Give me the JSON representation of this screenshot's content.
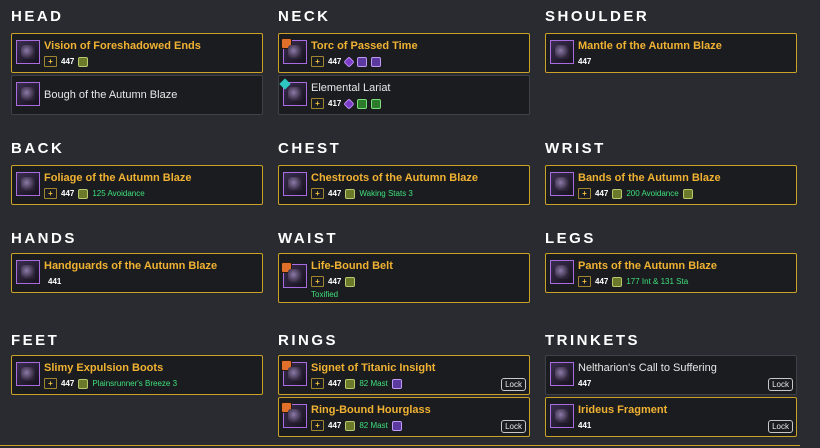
{
  "slots": {
    "head": {
      "title": "HEAD",
      "items": [
        {
          "name": "Vision of Foreshadowed Ends",
          "plus": "+",
          "ilvl": "447"
        },
        {
          "name": "Bough of the Autumn Blaze"
        }
      ]
    },
    "neck": {
      "title": "NECK",
      "items": [
        {
          "name": "Torc of Passed Time",
          "plus": "+",
          "ilvl": "447"
        },
        {
          "name": "Elemental Lariat",
          "plus": "+",
          "ilvl": "417"
        }
      ]
    },
    "shoulder": {
      "title": "SHOULDER",
      "items": [
        {
          "name": "Mantle of the Autumn Blaze",
          "ilvl": "447"
        }
      ]
    },
    "back": {
      "title": "BACK",
      "items": [
        {
          "name": "Foliage of the Autumn Blaze",
          "plus": "+",
          "ilvl": "447",
          "enchant": "125 Avoidance"
        }
      ]
    },
    "chest": {
      "title": "CHEST",
      "items": [
        {
          "name": "Chestroots of the Autumn Blaze",
          "plus": "+",
          "ilvl": "447",
          "enchant": "Waking Stats 3"
        }
      ]
    },
    "wrist": {
      "title": "WRIST",
      "items": [
        {
          "name": "Bands of the Autumn Blaze",
          "plus": "+",
          "ilvl": "447",
          "enchant": "200 Avoidance"
        }
      ]
    },
    "hands": {
      "title": "HANDS",
      "items": [
        {
          "name": "Handguards of the Autumn Blaze",
          "ilvl": "441"
        }
      ]
    },
    "waist": {
      "title": "WAIST",
      "items": [
        {
          "name": "Life-Bound Belt",
          "plus": "+",
          "ilvl": "447",
          "sub": "Toxified"
        }
      ]
    },
    "legs": {
      "title": "LEGS",
      "items": [
        {
          "name": "Pants of the Autumn Blaze",
          "plus": "+",
          "ilvl": "447",
          "enchant": "177 Int & 131 Sta"
        }
      ]
    },
    "feet": {
      "title": "FEET",
      "items": [
        {
          "name": "Slimy Expulsion Boots",
          "plus": "+",
          "ilvl": "447",
          "enchant": "Plainsrunner's Breeze 3"
        }
      ]
    },
    "rings": {
      "title": "RINGS",
      "items": [
        {
          "name": "Signet of Titanic Insight",
          "plus": "+",
          "ilvl": "447",
          "enchant": "82 Mast",
          "lock": "Lock"
        },
        {
          "name": "Ring-Bound Hourglass",
          "plus": "+",
          "ilvl": "447",
          "enchant": "82 Mast",
          "lock": "Lock"
        }
      ]
    },
    "trinkets": {
      "title": "TRINKETS",
      "items": [
        {
          "name": "Neltharion's Call to Suffering",
          "ilvl": "447",
          "lock": "Lock"
        },
        {
          "name": "Irideus Fragment",
          "ilvl": "441",
          "lock": "Lock"
        }
      ]
    }
  },
  "colors": {
    "background": "#2a2b30",
    "card": "#1b1c20",
    "gold_border": "#c9a227",
    "epic_name": "#f0b232",
    "enchant_text": "#3ee07a"
  },
  "icons": [
    "crafted-item-icon",
    "gem-icon",
    "rune-socket-icon",
    "enchant-icon",
    "upgrade-plus-icon"
  ]
}
